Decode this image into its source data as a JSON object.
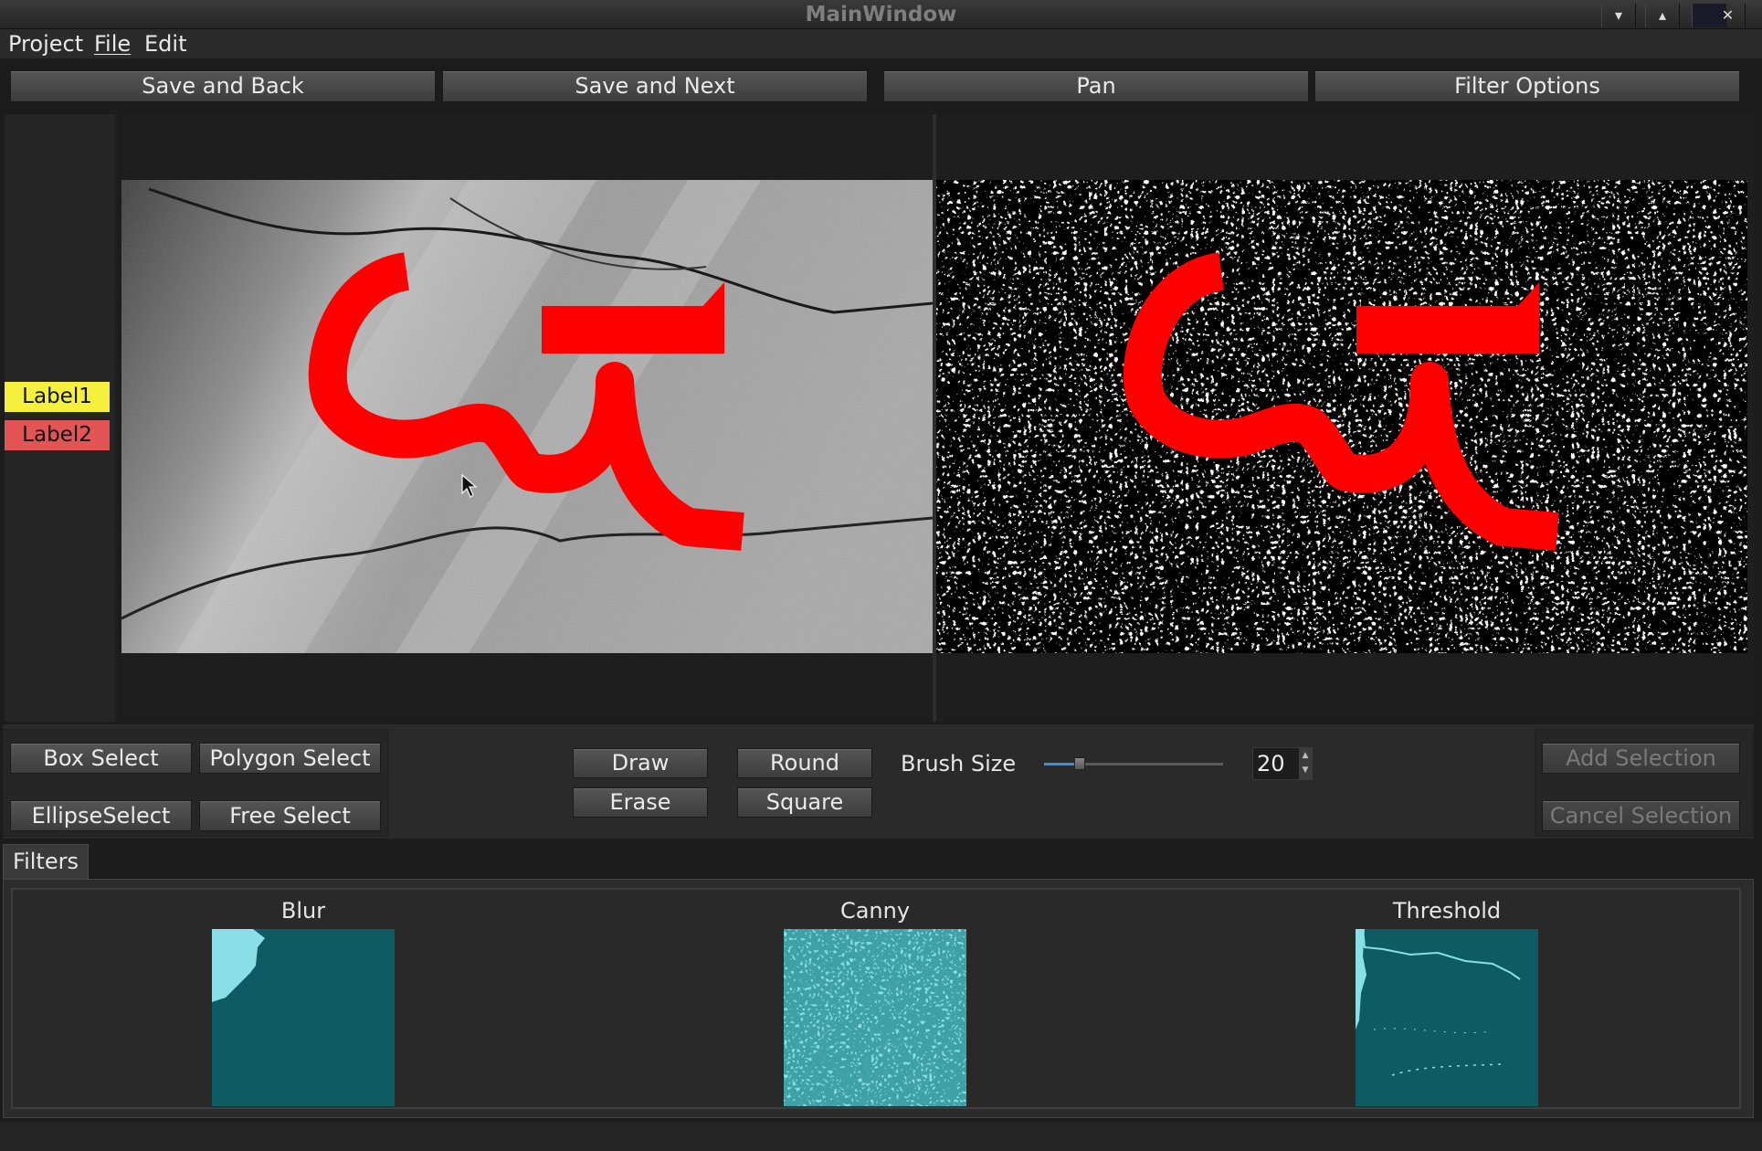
{
  "window": {
    "title": "MainWindow",
    "controls": [
      "▾",
      "▴",
      "✕"
    ]
  },
  "menu": [
    "Project",
    "File",
    "Edit"
  ],
  "toolbar": {
    "save_back": "Save and Back",
    "save_next": "Save and Next",
    "pan": "Pan",
    "filter_options": "Filter Options"
  },
  "labels": [
    {
      "text": "Label1",
      "color": "#f5f03c"
    },
    {
      "text": "Label2",
      "color": "#e35555"
    }
  ],
  "selection_tools": {
    "box": "Box Select",
    "polygon": "Polygon Select",
    "ellipse": "EllipseSelect",
    "free": "Free Select"
  },
  "brush": {
    "draw": "Draw",
    "erase": "Erase",
    "round": "Round",
    "square": "Square",
    "size_label": "Brush Size",
    "size_value": "20",
    "slider_fraction": 0.2
  },
  "selection_actions": {
    "add": "Add Selection",
    "cancel": "Cancel Selection"
  },
  "filters": {
    "tab": "Filters",
    "items": [
      "Blur",
      "Canny",
      "Threshold"
    ]
  },
  "colors": {
    "annotation": "#ff0000",
    "thumb_dark": "#0e5c63",
    "thumb_light": "#8adfe6"
  }
}
